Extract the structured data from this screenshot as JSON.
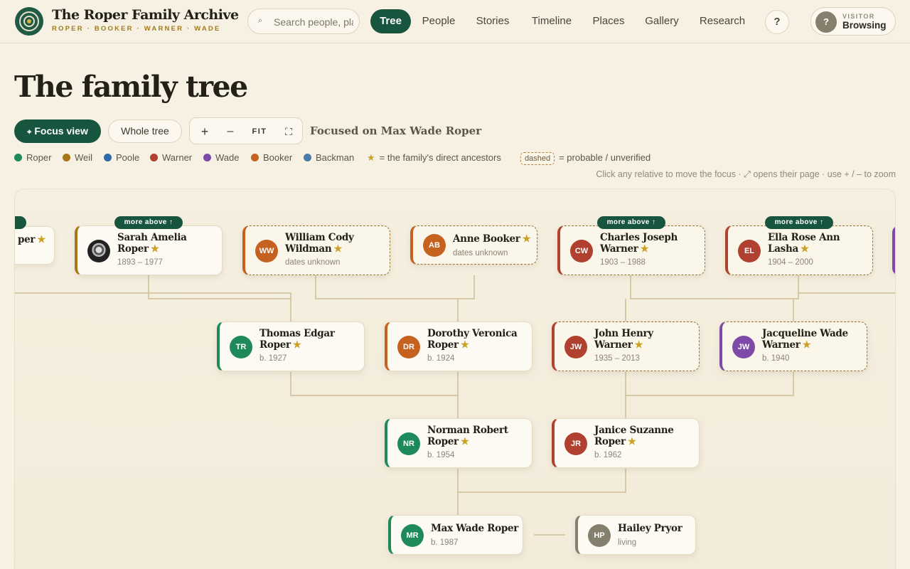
{
  "brand": {
    "title": "The Roper Family Archive",
    "subtitle": "ROPER · BOOKER · WARNER · WADE"
  },
  "search": {
    "placeholder": "Search people, places, stories",
    "icon": "search-icon"
  },
  "nav": {
    "items": [
      {
        "label": "Tree",
        "active": true
      },
      {
        "label": "People"
      },
      {
        "label": "Stories"
      },
      {
        "label": "Timeline"
      },
      {
        "label": "Places"
      },
      {
        "label": "Gallery"
      },
      {
        "label": "Research"
      }
    ],
    "help_label": "?"
  },
  "visitor": {
    "initial": "?",
    "role": "VISITOR",
    "status": "Browsing"
  },
  "page": {
    "title": "The family tree"
  },
  "controls": {
    "focus_view": "Focus view",
    "whole_tree": "Whole tree",
    "zoom_in": "+",
    "zoom_out": "–",
    "fit": "FIT",
    "focused_on": "Focused on Max Wade Roper"
  },
  "legend": {
    "families": [
      {
        "name": "Roper",
        "color": "#1e8a5a"
      },
      {
        "name": "Weil",
        "color": "#a8761a"
      },
      {
        "name": "Poole",
        "color": "#2f69a8"
      },
      {
        "name": "Warner",
        "color": "#b0402f"
      },
      {
        "name": "Wade",
        "color": "#7e4aa8"
      },
      {
        "name": "Booker",
        "color": "#c5621f"
      },
      {
        "name": "Backman",
        "color": "#4a7aa8"
      }
    ],
    "direct_ancestors": "= the family's direct ancestors",
    "dashed_chip": "dashed",
    "dashed_meaning": "= probable / unverified"
  },
  "hint": "Click any relative to move the focus · ⤢ opens their page · use + / – to zoom",
  "tree": {
    "more_above_label": "more above ↑",
    "partial_left_name": "per",
    "people": {
      "sarah": {
        "name": "Sarah Amelia Roper",
        "dates": "1893 – 1977",
        "initials": "",
        "color": "#a8761a"
      },
      "william": {
        "name": "William Cody Wildman",
        "dates": "dates unknown",
        "initials": "WW",
        "color": "#c5621f"
      },
      "anne": {
        "name": "Anne Booker",
        "dates": "dates unknown",
        "initials": "AB",
        "color": "#c5621f"
      },
      "charles": {
        "name": "Charles Joseph Warner",
        "dates": "1903 – 1988",
        "initials": "CW",
        "color": "#b0402f"
      },
      "ella": {
        "name": "Ella Rose Ann Lasha",
        "dates": "1904 – 2000",
        "initials": "EL",
        "color": "#b0402f"
      },
      "thomas": {
        "name": "Thomas Edgar Roper",
        "dates": "b. 1927",
        "initials": "TR",
        "color": "#1e8a5a"
      },
      "dorothy": {
        "name": "Dorothy Veronica Roper",
        "dates": "b. 1924",
        "initials": "DR",
        "color": "#c5621f"
      },
      "john": {
        "name": "John Henry Warner",
        "dates": "1935 – 2013",
        "initials": "JW",
        "color": "#b0402f"
      },
      "jacqueline": {
        "name": "Jacqueline Wade Warner",
        "dates": "b. 1940",
        "initials": "JW",
        "color": "#7e4aa8"
      },
      "norman": {
        "name": "Norman Robert Roper",
        "dates": "b. 1954",
        "initials": "NR",
        "color": "#1e8a5a"
      },
      "janice": {
        "name": "Janice Suzanne Roper",
        "dates": "b. 1962",
        "initials": "JR",
        "color": "#b0402f"
      },
      "max": {
        "name": "Max Wade Roper",
        "dates": "b. 1987",
        "initials": "MR",
        "color": "#1e8a5a"
      },
      "hailey": {
        "name": "Hailey Pryor",
        "dates": "living",
        "initials": "HP",
        "color": "#857f6e"
      }
    }
  }
}
